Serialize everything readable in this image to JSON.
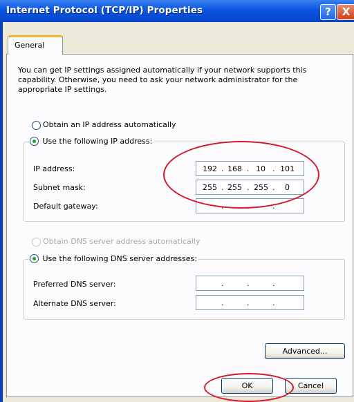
{
  "window": {
    "title": "Internet Protocol (TCP/IP) Properties",
    "help_glyph": "?",
    "close_glyph": "X"
  },
  "tabs": [
    {
      "label": "General",
      "selected": true
    }
  ],
  "intro_text": "You can get IP settings assigned automatically if your network supports this capability. Otherwise, you need to ask your network administrator for the appropriate IP settings.",
  "ip_section": {
    "auto_option": {
      "label": "Obtain an IP address automatically",
      "checked": false
    },
    "manual_option": {
      "label": "Use the following IP address:",
      "checked": true
    },
    "fields": [
      {
        "label": "IP address:",
        "value": [
          "192",
          "168",
          "10",
          "101"
        ]
      },
      {
        "label": "Subnet mask:",
        "value": [
          "255",
          "255",
          "255",
          "0"
        ]
      },
      {
        "label": "Default gateway:",
        "value": [
          "",
          "",
          "",
          ""
        ]
      }
    ]
  },
  "dns_section": {
    "auto_option": {
      "label": "Obtain DNS server address automatically",
      "checked": false,
      "disabled": true
    },
    "manual_option": {
      "label": "Use the following DNS server addresses:",
      "checked": true
    },
    "fields": [
      {
        "label": "Preferred DNS server:",
        "value": [
          "",
          "",
          "",
          ""
        ]
      },
      {
        "label": "Alternate DNS server:",
        "value": [
          "",
          "",
          "",
          ""
        ]
      }
    ]
  },
  "buttons": {
    "advanced": "Advanced...",
    "ok": "OK",
    "cancel": "Cancel"
  },
  "colors": {
    "annotation_red": "#d7152a",
    "title_blue": "#0a55e0",
    "dialog_face": "#ece9d8"
  }
}
